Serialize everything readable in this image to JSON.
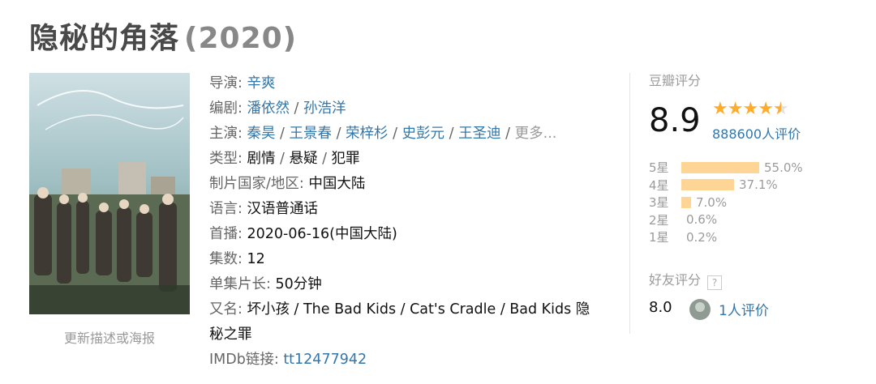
{
  "title": {
    "name": "隐秘的角落",
    "year": "(2020)"
  },
  "poster": {
    "update_link": "更新描述或海报"
  },
  "info": {
    "director_label": "导演",
    "director": "辛爽",
    "writer_label": "编剧",
    "writers": [
      "潘依然",
      "孙浩洋"
    ],
    "cast_label": "主演",
    "cast": [
      "秦昊",
      "王景春",
      "荣梓杉",
      "史彭元",
      "王圣迪"
    ],
    "cast_more": "更多...",
    "genre_label": "类型",
    "genres": [
      "剧情",
      "悬疑",
      "犯罪"
    ],
    "country_label": "制片国家/地区",
    "country": "中国大陆",
    "language_label": "语言",
    "language": "汉语普通话",
    "premiere_label": "首播",
    "premiere": "2020-06-16(中国大陆)",
    "episodes_label": "集数",
    "episodes": "12",
    "runtime_label": "单集片长",
    "runtime": "50分钟",
    "aka_label": "又名",
    "aka": "坏小孩 / The Bad Kids / Cat's Cradle / Bad Kids 隐秘之罪",
    "imdb_label": "IMDb链接",
    "imdb": "tt12477942"
  },
  "rating": {
    "label": "豆瓣评分",
    "score": "8.9",
    "stars": 4.5,
    "votes": "888600人评价",
    "colors": {
      "star": "#ffac2d",
      "bar": "#ffd596",
      "link": "#3377aa"
    },
    "distribution": [
      {
        "label": "5星",
        "percent": "55.0%",
        "value": 55.0
      },
      {
        "label": "4星",
        "percent": "37.1%",
        "value": 37.1
      },
      {
        "label": "3星",
        "percent": "7.0%",
        "value": 7.0
      },
      {
        "label": "2星",
        "percent": "0.6%",
        "value": 0.6
      },
      {
        "label": "1星",
        "percent": "0.2%",
        "value": 0.2
      }
    ]
  },
  "friends": {
    "label": "好友评分",
    "help_icon": "?",
    "score": "8.0",
    "votes": "1人评价"
  }
}
